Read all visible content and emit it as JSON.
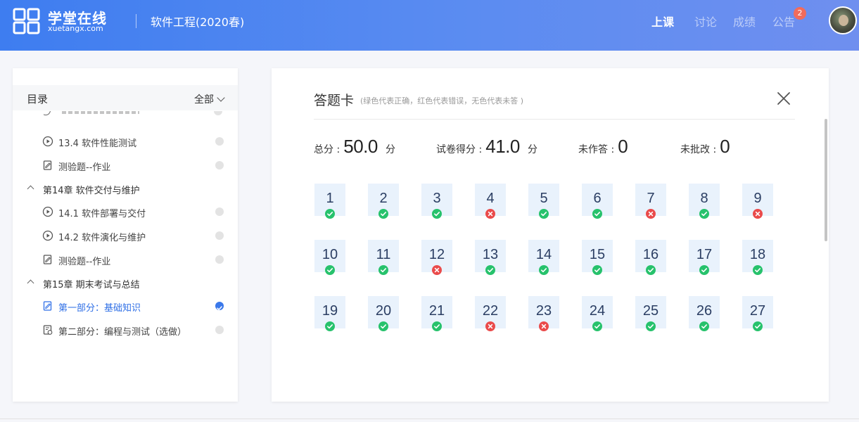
{
  "header": {
    "logo_cn": "学堂在线",
    "logo_en": "xuetangx.com",
    "course_title": "软件工程(2020春)",
    "nav": [
      {
        "label": "上课",
        "active": true
      },
      {
        "label": "讨论",
        "active": false
      },
      {
        "label": "成绩",
        "active": false
      },
      {
        "label": "公告",
        "active": false
      }
    ],
    "notice_badge": "2"
  },
  "sidebar": {
    "title": "目录",
    "filter": "全部",
    "items": [
      {
        "type": "video",
        "label": "13.4 软件性能测试"
      },
      {
        "type": "quiz",
        "label": "测验题--作业"
      },
      {
        "type": "chapter",
        "label": "第14章 软件交付与维护"
      },
      {
        "type": "video",
        "label": "14.1 软件部署与交付"
      },
      {
        "type": "video",
        "label": "14.2 软件演化与维护"
      },
      {
        "type": "quiz",
        "label": "测验题--作业"
      },
      {
        "type": "chapter",
        "label": "第15章 期末考试与总结"
      },
      {
        "type": "quiz",
        "label": "第一部分：基础知识",
        "current": true
      },
      {
        "type": "exam",
        "label": "第二部分：编程与测试（选做）"
      }
    ]
  },
  "answer_card": {
    "title": "答题卡",
    "subtitle": "(绿色代表正确，红色代表错误，无色代表未答 )",
    "stats": {
      "total_label": "总分 :",
      "total_value": "50.0",
      "total_unit": "分",
      "score_label": "试卷得分 :",
      "score_value": "41.0",
      "score_unit": "分",
      "unanswered_label": "未作答 :",
      "unanswered_value": "0",
      "ungraded_label": "未批改 :",
      "ungraded_value": "0"
    },
    "questions": [
      {
        "n": "1",
        "correct": true
      },
      {
        "n": "2",
        "correct": true
      },
      {
        "n": "3",
        "correct": true
      },
      {
        "n": "4",
        "correct": false
      },
      {
        "n": "5",
        "correct": true
      },
      {
        "n": "6",
        "correct": true
      },
      {
        "n": "7",
        "correct": false
      },
      {
        "n": "8",
        "correct": true
      },
      {
        "n": "9",
        "correct": false
      },
      {
        "n": "10",
        "correct": true
      },
      {
        "n": "11",
        "correct": true
      },
      {
        "n": "12",
        "correct": false
      },
      {
        "n": "13",
        "correct": true
      },
      {
        "n": "14",
        "correct": true
      },
      {
        "n": "15",
        "correct": true
      },
      {
        "n": "16",
        "correct": true
      },
      {
        "n": "17",
        "correct": true
      },
      {
        "n": "18",
        "correct": true
      },
      {
        "n": "19",
        "correct": true
      },
      {
        "n": "20",
        "correct": true
      },
      {
        "n": "21",
        "correct": true
      },
      {
        "n": "22",
        "correct": false
      },
      {
        "n": "23",
        "correct": false
      },
      {
        "n": "24",
        "correct": true
      },
      {
        "n": "25",
        "correct": true
      },
      {
        "n": "26",
        "correct": true
      },
      {
        "n": "27",
        "correct": true
      }
    ]
  },
  "colors": {
    "header_start": "#3e7df0",
    "header_end": "#6f8fef",
    "correct": "#27c26c",
    "wrong": "#ea4b4b",
    "current": "#2f6fe6",
    "tile": "#e9f2fc"
  }
}
